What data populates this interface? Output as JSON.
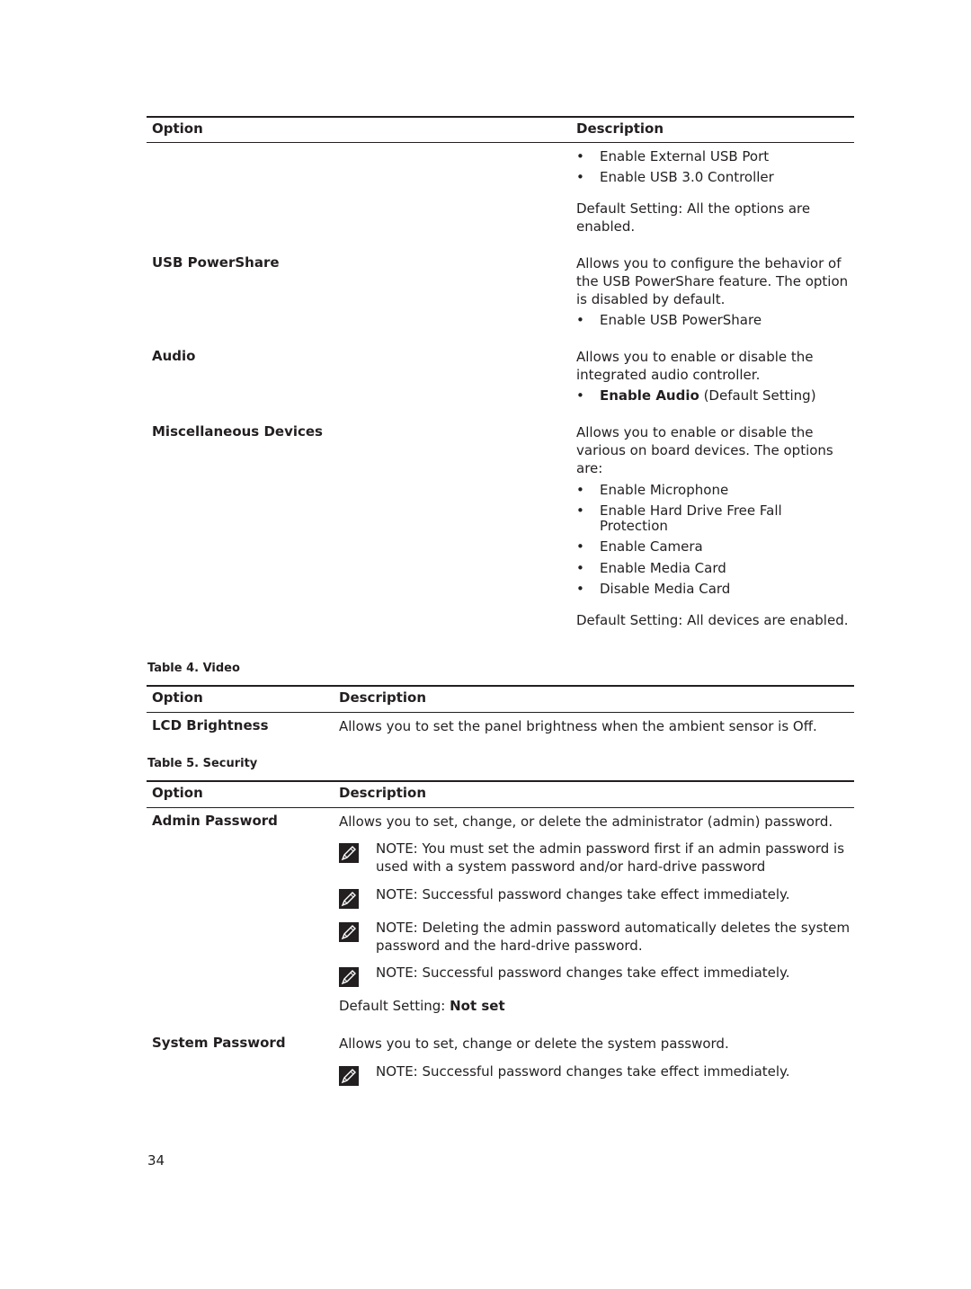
{
  "table3_continued": {
    "headers": {
      "option": "Option",
      "description": "Description"
    },
    "leading_bullets": [
      "Enable External USB Port",
      "Enable USB 3.0 Controller"
    ],
    "leading_default": "Default Setting: All the options are enabled.",
    "rows": [
      {
        "option": "USB PowerShare",
        "description": "Allows you to configure the behavior of the USB PowerShare feature. The option is disabled by default.",
        "description_lines": [
          "Allows you to configure the behavior of",
          "the USB PowerShare feature. The option",
          "is disabled by default."
        ],
        "bullets": [
          "Enable USB PowerShare"
        ]
      },
      {
        "option": "Audio",
        "description": "Allows you to enable or disable the integrated audio controller.",
        "description_lines": [
          "Allows you to enable or disable the",
          "integrated audio controller."
        ],
        "bullet_bold": "Enable Audio",
        "bullet_rest": " (Default Setting)"
      },
      {
        "option": "Miscellaneous Devices",
        "description": "Allows you to enable or disable the various on board devices. The options are:",
        "description_lines": [
          "Allows you to enable or disable the",
          "various on board devices. The options",
          "are:"
        ],
        "bullets": [
          "Enable Microphone",
          "Enable Hard Drive Free Fall",
          "Protection",
          "Enable Camera",
          "Enable Media Card",
          "Disable Media Card"
        ],
        "default": "Default Setting: All devices are enabled."
      }
    ]
  },
  "table4": {
    "caption": "Table 4. Video",
    "headers": {
      "option": "Option",
      "description": "Description"
    },
    "rows": [
      {
        "option": "LCD Brightness",
        "description": "Allows you to set the panel brightness when the ambient sensor is Off."
      }
    ]
  },
  "table5": {
    "caption": "Table 5. Security",
    "headers": {
      "option": "Option",
      "description": "Description"
    },
    "rows": [
      {
        "option": "Admin Password",
        "description": "Allows you to set, change, or delete the administrator (admin) password.",
        "notes": [
          {
            "label": "NOTE:",
            "text": " You must set the admin password first if an admin password is used with a system password and/or hard-drive password"
          },
          {
            "label": "NOTE:",
            "text": " Successful password changes take effect immediately."
          },
          {
            "label": "NOTE:",
            "text": " Deleting the admin password automatically deletes the system password and the hard-drive password."
          },
          {
            "label": "NOTE:",
            "text": " Successful password changes take effect immediately."
          }
        ],
        "default_label": "Default Setting: ",
        "default_value": "Not set"
      },
      {
        "option": "System Password",
        "description": "Allows you to set, change or delete the system password.",
        "notes": [
          {
            "label": "NOTE:",
            "text": " Successful password changes take effect immediately."
          }
        ]
      }
    ]
  },
  "page_number": "34",
  "icons": {
    "note": "pencil-note-icon"
  }
}
